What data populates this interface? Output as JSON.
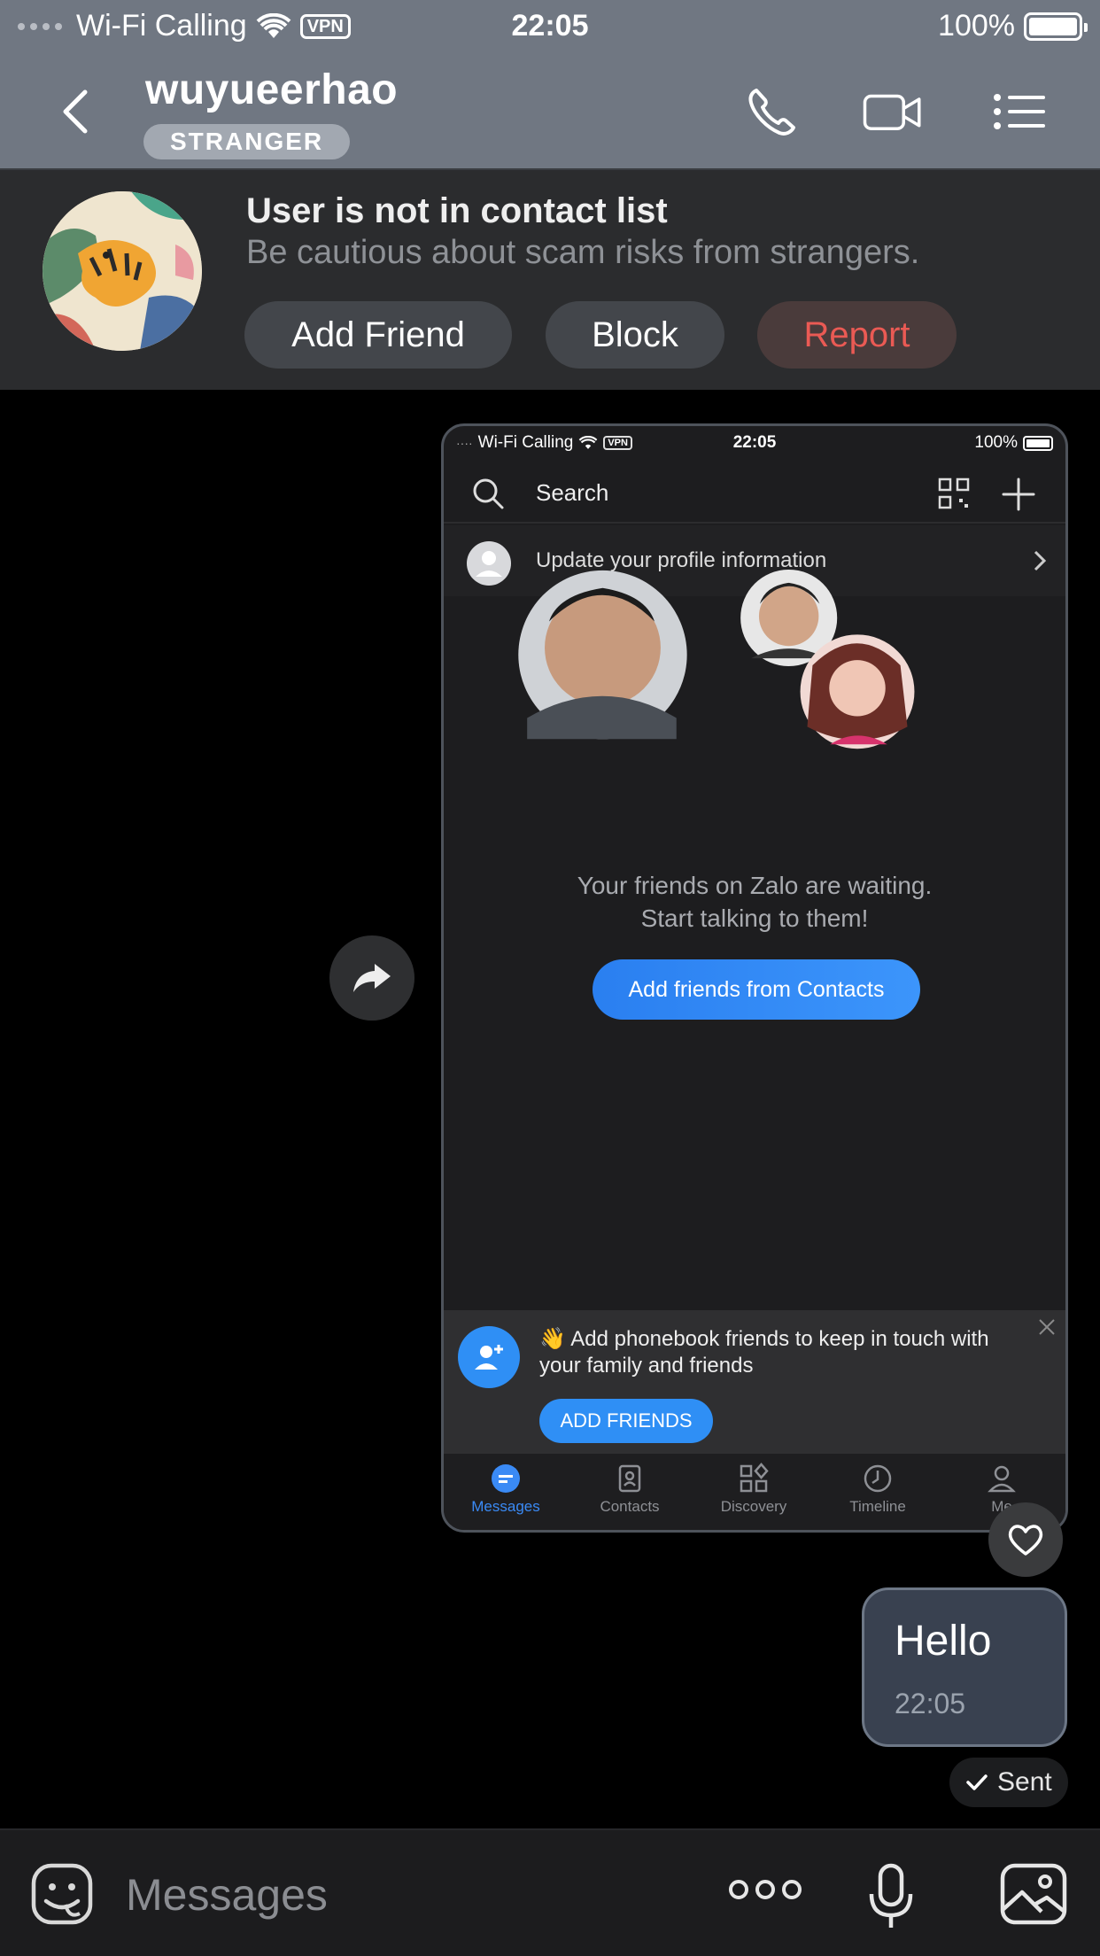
{
  "status_bar": {
    "carrier": "Wi-Fi Calling",
    "vpn": "VPN",
    "time": "22:05",
    "battery": "100%"
  },
  "header": {
    "name": "wuyueerhao",
    "badge": "STRANGER",
    "icons": [
      "back-icon",
      "phone-icon",
      "video-call-icon",
      "menu-icon"
    ]
  },
  "banner": {
    "title": "User is not in contact list",
    "subtitle": "Be cautious about scam risks from strangers.",
    "add_friend": "Add Friend",
    "block": "Block",
    "report": "Report"
  },
  "screenshot_message": {
    "status": {
      "carrier": "Wi-Fi Calling",
      "vpn": "VPN",
      "time": "22:05",
      "battery": "100%"
    },
    "search_placeholder": "Search",
    "update_profile": "Update your profile information",
    "waiting_line1": "Your friends on Zalo are waiting.",
    "waiting_line2": "Start talking to them!",
    "add_contacts_button": "Add friends from Contacts",
    "card_text": "👋 Add phonebook friends to keep in touch with your family and friends",
    "card_button": "ADD FRIENDS",
    "tabs": [
      "Messages",
      "Contacts",
      "Discovery",
      "Timeline",
      "Me"
    ]
  },
  "messages": [
    {
      "text": "Hello",
      "time": "22:05",
      "status": "Sent"
    }
  ],
  "input_bar": {
    "placeholder": "Messages"
  },
  "colors": {
    "header_bg": "#707782",
    "banner_bg": "#2b2c2e",
    "report_text": "#ea5a54",
    "accent_blue": "#2f8ff5",
    "bubble_bg": "#394150"
  }
}
